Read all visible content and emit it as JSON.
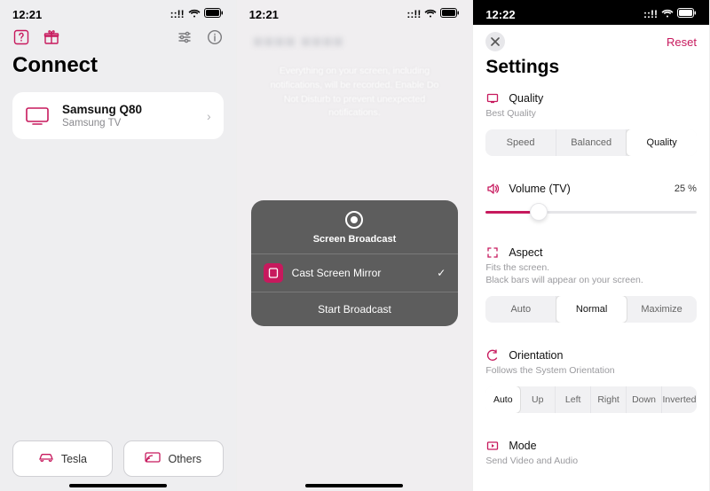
{
  "screen1": {
    "time": "12:21",
    "title": "Connect",
    "device": {
      "name": "Samsung Q80",
      "sub": "Samsung TV"
    },
    "buttons": {
      "tesla": "Tesla",
      "others": "Others"
    }
  },
  "screen2": {
    "time": "12:21",
    "hint": "Everything on your screen, including notifications, will be recorded. Enable Do Not Disturb to prevent unexpected notifications.",
    "modal": {
      "title": "Screen Broadcast",
      "app": "Cast Screen Mirror",
      "start": "Start Broadcast"
    }
  },
  "screen3": {
    "time": "12:22",
    "reset": "Reset",
    "title": "Settings",
    "quality": {
      "label": "Quality",
      "sub": "Best Quality",
      "options": [
        "Speed",
        "Balanced",
        "Quality"
      ],
      "active": 2
    },
    "volume": {
      "label": "Volume (TV)",
      "value": "25 %",
      "percent": 25
    },
    "aspect": {
      "label": "Aspect",
      "sub1": "Fits the screen.",
      "sub2": "Black bars will appear on your screen.",
      "options": [
        "Auto",
        "Normal",
        "Maximize"
      ],
      "active": 1
    },
    "orientation": {
      "label": "Orientation",
      "sub": "Follows the System Orientation",
      "options": [
        "Auto",
        "Up",
        "Left",
        "Right",
        "Down",
        "Inverted"
      ],
      "active": 0
    },
    "mode": {
      "label": "Mode",
      "sub": "Send Video and Audio"
    }
  }
}
